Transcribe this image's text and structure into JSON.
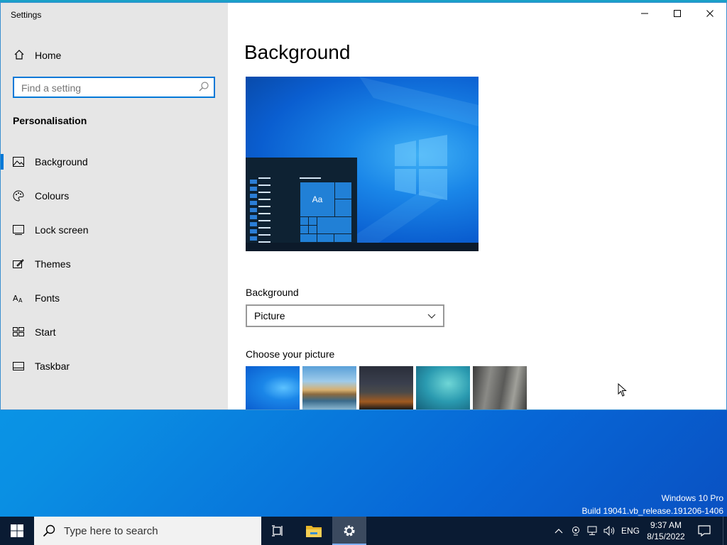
{
  "window": {
    "title": "Settings",
    "controls": {
      "minimize": "minimize",
      "maximize": "maximize",
      "close": "close"
    }
  },
  "sidebar": {
    "home_label": "Home",
    "search_placeholder": "Find a setting",
    "section_title": "Personalisation",
    "items": [
      {
        "label": "Background",
        "icon": "picture-icon",
        "active": true
      },
      {
        "label": "Colours",
        "icon": "palette-icon",
        "active": false
      },
      {
        "label": "Lock screen",
        "icon": "lock-screen-icon",
        "active": false
      },
      {
        "label": "Themes",
        "icon": "themes-icon",
        "active": false
      },
      {
        "label": "Fonts",
        "icon": "fonts-icon",
        "active": false
      },
      {
        "label": "Start",
        "icon": "start-icon",
        "active": false
      },
      {
        "label": "Taskbar",
        "icon": "taskbar-icon",
        "active": false
      }
    ]
  },
  "main": {
    "heading": "Background",
    "preview": {
      "tile_text": "Aa"
    },
    "background_label": "Background",
    "background_value": "Picture",
    "choose_label": "Choose your picture",
    "thumbnails": [
      "windows-blue",
      "beach-rocks",
      "night-sky",
      "underwater-swimmer",
      "rock-cliff"
    ]
  },
  "desktop": {
    "watermark_line1": "Windows 10 Pro",
    "watermark_line2": "Build 19041.vb_release.191206-1406"
  },
  "taskbar": {
    "search_placeholder": "Type here to search",
    "language": "ENG",
    "time": "9:37 AM",
    "date": "8/15/2022"
  },
  "colors": {
    "accent": "#0078d7",
    "sidebar_bg": "#e6e6e6",
    "taskbar_bg": "#0a1b33"
  }
}
